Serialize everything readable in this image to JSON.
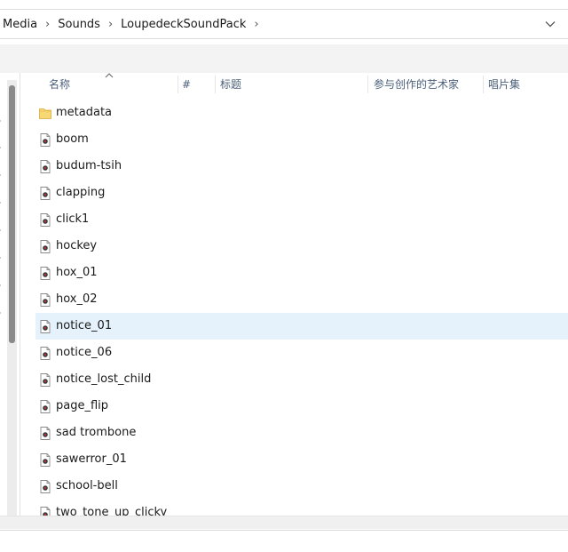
{
  "breadcrumb": {
    "items": [
      "Media",
      "Sounds",
      "LoupedeckSoundPack"
    ]
  },
  "address_bar": {
    "dropdown_icon": "chevron-down-icon"
  },
  "columns": {
    "name": "名称",
    "number": "#",
    "title": "标题",
    "contributing_artists": "参与创作的艺术家",
    "album": "唱片集"
  },
  "files": [
    {
      "name": "metadata",
      "type": "folder"
    },
    {
      "name": "boom",
      "type": "audio"
    },
    {
      "name": "budum-tsih",
      "type": "audio"
    },
    {
      "name": "clapping",
      "type": "audio"
    },
    {
      "name": "click1",
      "type": "audio"
    },
    {
      "name": "hockey",
      "type": "audio"
    },
    {
      "name": "hox_01",
      "type": "audio"
    },
    {
      "name": "hox_02",
      "type": "audio"
    },
    {
      "name": "notice_01",
      "type": "audio",
      "selected": true
    },
    {
      "name": "notice_06",
      "type": "audio"
    },
    {
      "name": "notice_lost_child",
      "type": "audio"
    },
    {
      "name": "page_flip",
      "type": "audio"
    },
    {
      "name": "sad trombone",
      "type": "audio"
    },
    {
      "name": "sawerror_01",
      "type": "audio"
    },
    {
      "name": "school-bell",
      "type": "audio"
    },
    {
      "name": "two_tone_up_clicky",
      "type": "audio"
    }
  ],
  "colors": {
    "selection": "#e5f1fb",
    "header_text": "#4c607a",
    "folder": "#f8d775",
    "audio_icon_accent": "#b23a3a"
  }
}
